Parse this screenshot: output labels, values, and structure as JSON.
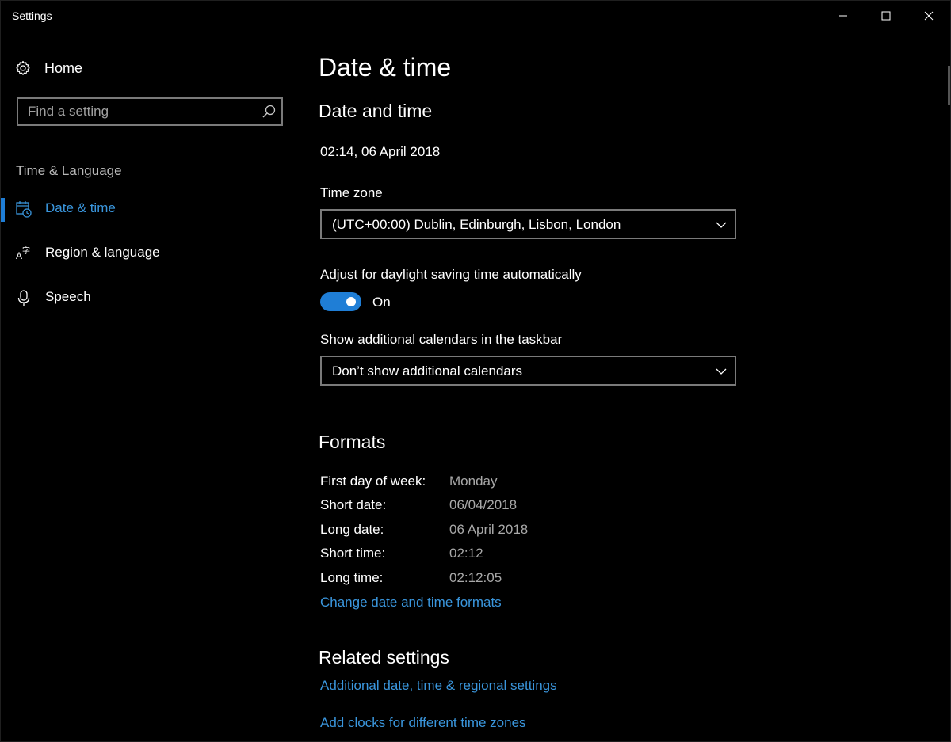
{
  "window": {
    "title": "Settings",
    "controls": {
      "minimize": "minimize",
      "maximize": "maximize",
      "close": "close"
    }
  },
  "sidebar": {
    "home_label": "Home",
    "search_placeholder": "Find a setting",
    "section_label": "Time & Language",
    "items": [
      {
        "label": "Date & time",
        "icon": "calendar-clock-icon",
        "active": true
      },
      {
        "label": "Region & language",
        "icon": "language-icon",
        "active": false
      },
      {
        "label": "Speech",
        "icon": "microphone-icon",
        "active": false
      }
    ]
  },
  "main": {
    "page_title": "Date & time",
    "date_time_section": {
      "heading": "Date and time",
      "current": "02:14, 06 April 2018",
      "timezone_label": "Time zone",
      "timezone_value": "(UTC+00:00) Dublin, Edinburgh, Lisbon, London",
      "dst_label": "Adjust for daylight saving time automatically",
      "dst_state": "On",
      "calendars_label": "Show additional calendars in the taskbar",
      "calendars_value": "Don’t show additional calendars"
    },
    "formats_section": {
      "heading": "Formats",
      "rows": [
        {
          "key": "First day of week:",
          "value": "Monday"
        },
        {
          "key": "Short date:",
          "value": "06/04/2018"
        },
        {
          "key": "Long date:",
          "value": "06 April 2018"
        },
        {
          "key": "Short time:",
          "value": "02:12"
        },
        {
          "key": "Long time:",
          "value": "02:12:05"
        }
      ],
      "change_link": "Change date and time formats"
    },
    "related_section": {
      "heading": "Related settings",
      "links": [
        "Additional date, time & regional settings",
        "Add clocks for different time zones"
      ]
    }
  },
  "colors": {
    "accent": "#1f7ed6",
    "link": "#3a96dd",
    "background": "#000000",
    "muted_text": "#a8a8a8"
  }
}
